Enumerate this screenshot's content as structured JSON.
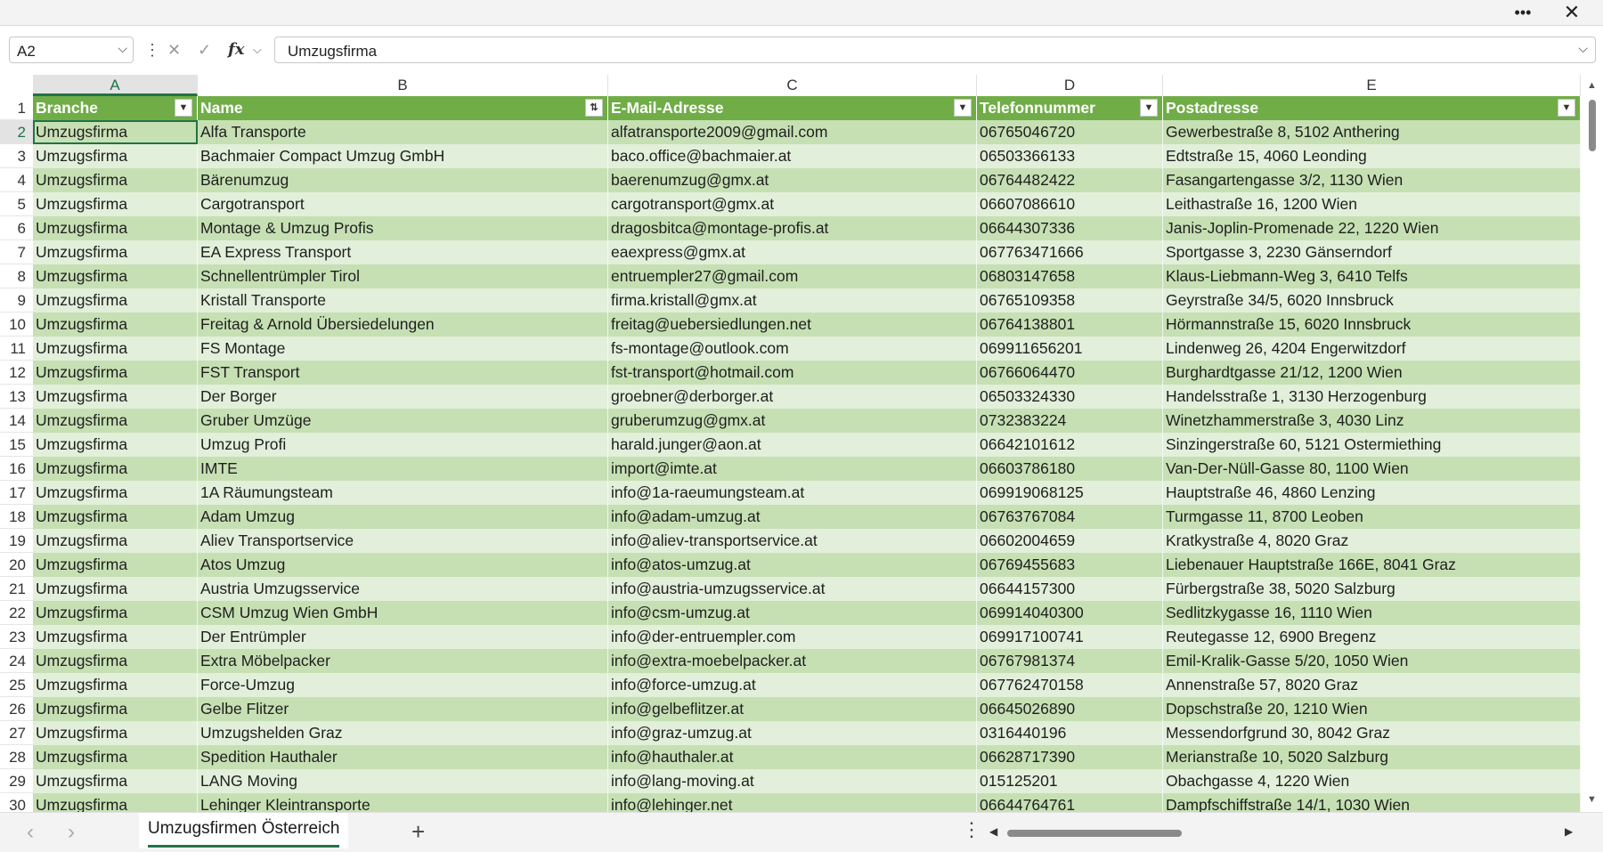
{
  "formula_bar": {
    "name_box": "A2",
    "formula": "Umzugsfirma"
  },
  "columns": [
    "A",
    "B",
    "C",
    "D",
    "E"
  ],
  "selected_column": "A",
  "table_headers": [
    "Branche",
    "Name",
    "E-Mail-Adresse",
    "Telefonnummer",
    "Postadresse"
  ],
  "rows": [
    {
      "num": "2",
      "cells": [
        "Umzugsfirma",
        "Alfa Transporte",
        "alfatransporte2009@gmail.com",
        "06765046720",
        "Gewerbestraße 8, 5102 Anthering"
      ]
    },
    {
      "num": "3",
      "cells": [
        "Umzugsfirma",
        "Bachmaier Compact Umzug GmbH",
        "baco.office@bachmaier.at",
        "06503366133",
        "Edtstraße 15, 4060 Leonding"
      ]
    },
    {
      "num": "4",
      "cells": [
        "Umzugsfirma",
        "Bärenumzug",
        "baerenumzug@gmx.at",
        "06764482422",
        "Fasangartengasse 3/2, 1130 Wien"
      ]
    },
    {
      "num": "5",
      "cells": [
        "Umzugsfirma",
        "Cargotransport",
        "cargotransport@gmx.at",
        "06607086610",
        "Leithastraße 16, 1200 Wien"
      ]
    },
    {
      "num": "6",
      "cells": [
        "Umzugsfirma",
        "Montage & Umzug Profis",
        "dragosbitca@montage-profis.at",
        "06644307336",
        "Janis-Joplin-Promenade 22, 1220 Wien"
      ]
    },
    {
      "num": "7",
      "cells": [
        "Umzugsfirma",
        "EA Express Transport",
        "eaexpress@gmx.at",
        "067763471666",
        "Sportgasse 3, 2230 Gänserndorf"
      ]
    },
    {
      "num": "8",
      "cells": [
        "Umzugsfirma",
        "Schnellentrümpler Tirol",
        "entruempler27@gmail.com",
        "06803147658",
        "Klaus-Liebmann-Weg 3, 6410 Telfs"
      ]
    },
    {
      "num": "9",
      "cells": [
        "Umzugsfirma",
        "Kristall Transporte",
        "firma.kristall@gmx.at",
        "06765109358",
        "Geyrstraße 34/5, 6020 Innsbruck"
      ]
    },
    {
      "num": "10",
      "cells": [
        "Umzugsfirma",
        "Freitag & Arnold Übersiedelungen",
        "freitag@uebersiedlungen.net",
        "06764138801",
        "Hörmannstraße 15, 6020 Innsbruck"
      ]
    },
    {
      "num": "11",
      "cells": [
        "Umzugsfirma",
        "FS Montage",
        "fs-montage@outlook.com",
        "069911656201",
        "Lindenweg 26, 4204 Engerwitzdorf"
      ]
    },
    {
      "num": "12",
      "cells": [
        "Umzugsfirma",
        "FST Transport",
        "fst-transport@hotmail.com",
        "06766064470",
        "Burghardtgasse 21/12, 1200 Wien"
      ]
    },
    {
      "num": "13",
      "cells": [
        "Umzugsfirma",
        "Der Borger",
        "groebner@derborger.at",
        "06503324330",
        "Handelsstraße 1, 3130 Herzogenburg"
      ]
    },
    {
      "num": "14",
      "cells": [
        "Umzugsfirma",
        "Gruber Umzüge",
        "gruberumzug@gmx.at",
        "0732383224",
        "Winetzhammerstraße 3, 4030 Linz"
      ]
    },
    {
      "num": "15",
      "cells": [
        "Umzugsfirma",
        "Umzug Profi",
        "harald.junger@aon.at",
        "06642101612",
        "Sinzingerstraße 60, 5121 Ostermiething"
      ]
    },
    {
      "num": "16",
      "cells": [
        "Umzugsfirma",
        "IMTE",
        "import@imte.at",
        "06603786180",
        "Van-Der-Nüll-Gasse 80, 1100 Wien"
      ]
    },
    {
      "num": "17",
      "cells": [
        "Umzugsfirma",
        "1A Räumungsteam",
        "info@1a-raeumungsteam.at",
        "069919068125",
        "Hauptstraße 46, 4860 Lenzing"
      ]
    },
    {
      "num": "18",
      "cells": [
        "Umzugsfirma",
        "Adam Umzug",
        "info@adam-umzug.at",
        "06763767084",
        "Turmgasse 11, 8700 Leoben"
      ]
    },
    {
      "num": "19",
      "cells": [
        "Umzugsfirma",
        "Aliev Transportservice",
        "info@aliev-transportservice.at",
        "06602004659",
        "Kratkystraße 4, 8020 Graz"
      ]
    },
    {
      "num": "20",
      "cells": [
        "Umzugsfirma",
        "Atos Umzug",
        "info@atos-umzug.at",
        "06769455683",
        "Liebenauer Hauptstraße 166E, 8041 Graz"
      ]
    },
    {
      "num": "21",
      "cells": [
        "Umzugsfirma",
        "Austria Umzugsservice",
        "info@austria-umzugsservice.at",
        "06644157300",
        "Fürbergstraße 38, 5020 Salzburg"
      ]
    },
    {
      "num": "22",
      "cells": [
        "Umzugsfirma",
        "CSM Umzug Wien GmbH",
        "info@csm-umzug.at",
        "069914040300",
        "Sedlitzkygasse 16, 1110 Wien"
      ]
    },
    {
      "num": "23",
      "cells": [
        "Umzugsfirma",
        "Der Entrümpler",
        "info@der-entruempler.com",
        "069917100741",
        "Reutegasse 12, 6900 Bregenz"
      ]
    },
    {
      "num": "24",
      "cells": [
        "Umzugsfirma",
        "Extra Möbelpacker",
        "info@extra-moebelpacker.at",
        "06767981374",
        "Emil-Kralik-Gasse 5/20, 1050 Wien"
      ]
    },
    {
      "num": "25",
      "cells": [
        "Umzugsfirma",
        "Force-Umzug",
        "info@force-umzug.at",
        "067762470158",
        "Annenstraße 57, 8020 Graz"
      ]
    },
    {
      "num": "26",
      "cells": [
        "Umzugsfirma",
        "Gelbe Flitzer",
        "info@gelbeflitzer.at",
        "06645026890",
        "Dopschstraße 20, 1210 Wien"
      ]
    },
    {
      "num": "27",
      "cells": [
        "Umzugsfirma",
        "Umzugshelden Graz",
        "info@graz-umzug.at",
        "0316440196",
        "Messendorfgrund 30, 8042 Graz"
      ]
    },
    {
      "num": "28",
      "cells": [
        "Umzugsfirma",
        "Spedition Hauthaler",
        "info@hauthaler.at",
        "06628717390",
        "Merianstraße 10, 5020 Salzburg"
      ]
    },
    {
      "num": "29",
      "cells": [
        "Umzugsfirma",
        "LANG Moving",
        "info@lang-moving.at",
        "015125201",
        "Obachgasse 4, 1220 Wien"
      ]
    },
    {
      "num": "30",
      "cells": [
        "Umzugsfirma",
        "Lehinger Kleintransporte",
        "info@lehinger.net",
        "06644764761",
        "Dampfschiffstraße 14/1, 1030 Wien"
      ]
    }
  ],
  "sheet_tab": "Umzugsfirmen Österreich",
  "colors": {
    "header_bg": "#70ad47",
    "band_dark": "#c6e0b4",
    "band_light": "#e2efda",
    "accent": "#217346"
  },
  "icons": {
    "more": "more-options-icon",
    "close": "close-icon",
    "cancel": "cancel-x-icon",
    "confirm": "confirm-check-icon",
    "function": "fx-icon",
    "filter": "filter-dropdown-icon",
    "add_sheet": "plus-icon"
  }
}
